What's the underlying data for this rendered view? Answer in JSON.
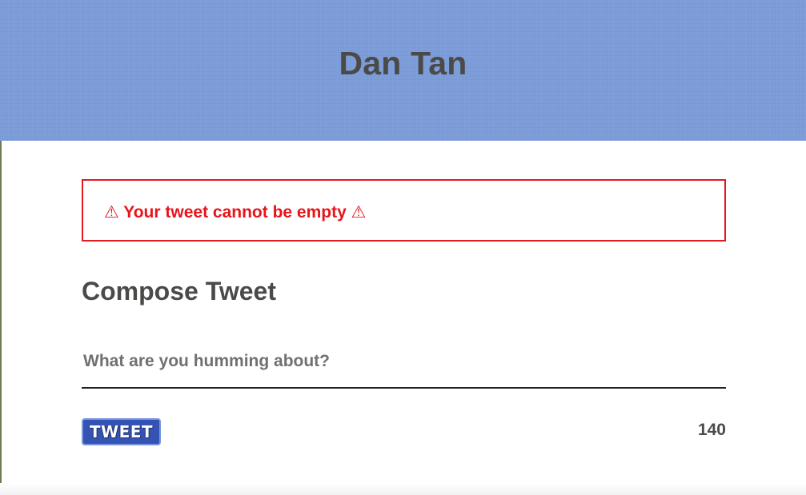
{
  "header": {
    "title": "Dan Tan",
    "background_color": "#7b9bd8"
  },
  "error": {
    "message": "⚠ Your tweet cannot be empty ⚠",
    "color": "#e8141a"
  },
  "compose": {
    "title": "Compose Tweet",
    "input_placeholder": "What are you humming about?",
    "input_value": "",
    "submit_label": "TWEET",
    "char_counter": "140"
  }
}
